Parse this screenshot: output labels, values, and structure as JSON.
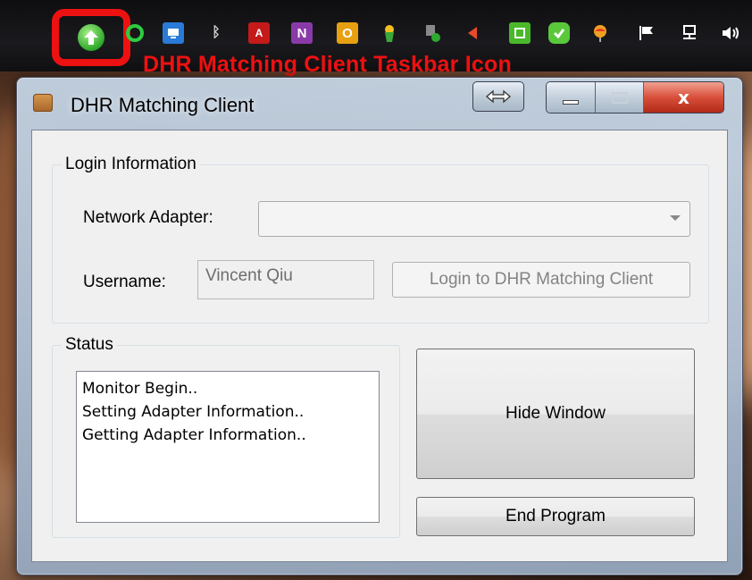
{
  "annotation": {
    "text": "DHR Matching Client Taskbar Icon",
    "color": "#ee1111"
  },
  "tray": {
    "icons": [
      {
        "name": "dhr-matching-client-tray-icon",
        "highlighted": true
      },
      {
        "name": "green-circle-icon"
      },
      {
        "name": "network-monitor-icon"
      },
      {
        "name": "bluetooth-icon"
      },
      {
        "name": "adobe-acrobat-icon"
      },
      {
        "name": "onenote-icon"
      },
      {
        "name": "outlook-icon"
      },
      {
        "name": "parrot-icon"
      },
      {
        "name": "usb-device-icon"
      },
      {
        "name": "red-arrow-icon"
      },
      {
        "name": "green-box-icon"
      },
      {
        "name": "green-check-icon"
      },
      {
        "name": "balloon-icon"
      },
      {
        "name": "action-center-flag-icon"
      },
      {
        "name": "network-icon"
      },
      {
        "name": "volume-icon"
      }
    ]
  },
  "window": {
    "title": "DHR Matching Client",
    "caption": {
      "close": "x"
    }
  },
  "login": {
    "group_title": "Login Information",
    "adapter_label": "Network Adapter:",
    "adapter_value": "",
    "username_label": "Username:",
    "username_value": "Vincent Qiu",
    "login_button": "Login to DHR Matching Client"
  },
  "status": {
    "group_title": "Status",
    "log": [
      "Monitor Begin..",
      "Setting Adapter Information..",
      "Getting Adapter Information.."
    ]
  },
  "buttons": {
    "hide": "Hide Window",
    "end": "End Program"
  }
}
